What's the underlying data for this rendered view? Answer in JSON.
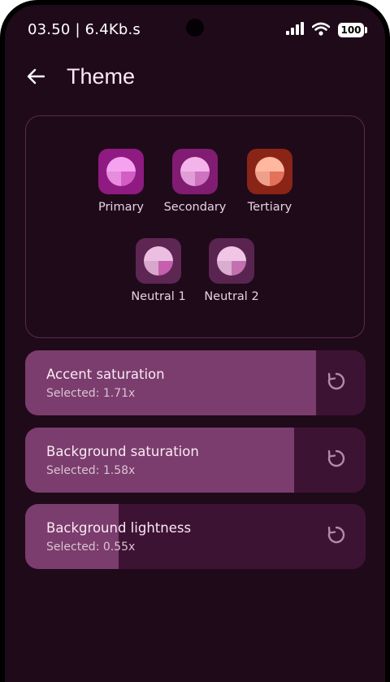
{
  "status_bar": {
    "time": "03.50 | 6.4Kb.s",
    "battery": "100",
    "icons": [
      "signal-icon",
      "wifi-icon",
      "battery-icon"
    ]
  },
  "app_bar": {
    "title": "Theme",
    "back_icon": "arrow-left-icon"
  },
  "palette": {
    "swatches": [
      {
        "label": "Primary",
        "tile_color": "#8f1a82",
        "light": "#f6a2ee",
        "dark": "#d25ec4"
      },
      {
        "label": "Secondary",
        "tile_color": "#811c72",
        "light": "#f2b4ea",
        "dark": "#cf73c1"
      },
      {
        "label": "Tertiary",
        "tile_color": "#8a2416",
        "light": "#ffb79f",
        "dark": "#e4715a"
      },
      {
        "label": "Neutral 1",
        "tile_color": "#5e2653",
        "light": "#ecbfe2",
        "dark": "#c55fae"
      },
      {
        "label": "Neutral 2",
        "tile_color": "#5a2450",
        "light": "#f0c5e6",
        "dark": "#c370b0"
      }
    ]
  },
  "sliders": [
    {
      "title": "Accent saturation",
      "value_text": "Selected: 1.71x",
      "fraction": 0.855
    },
    {
      "title": "Background saturation",
      "value_text": "Selected: 1.58x",
      "fraction": 0.79
    },
    {
      "title": "Background lightness",
      "value_text": "Selected: 0.55x",
      "fraction": 0.275
    }
  ],
  "colors": {
    "background": "#1f0a1a",
    "card_border": "#5a2a4e",
    "slider_track": "#3d1334",
    "slider_fill": "#7a3d6d"
  },
  "reset_icon": "reset-icon"
}
